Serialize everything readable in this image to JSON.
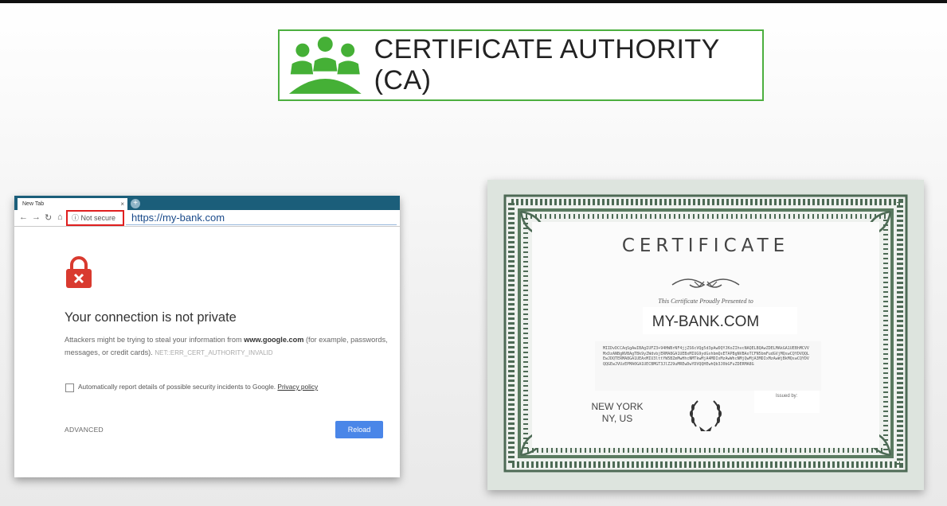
{
  "title": {
    "text": "CERTIFICATE AUTHORITY (CA)",
    "icon": "group-icon",
    "accent": "#4caf3f"
  },
  "browser": {
    "tab_label": "New Tab",
    "tab_close": "×",
    "new_tab": "+",
    "security_label": "Not secure",
    "url": "https://my-bank.com",
    "heading": "Your connection is not private",
    "body_before": "Attackers might be trying to steal your information from ",
    "body_domain": "www.google.com",
    "body_after": " (for example, passwords, messages, or credit cards). ",
    "error_code": "NET::ERR_CERT_AUTHORITY_INVALID",
    "checkbox_text": "Automatically report details of possible security incidents to Google. ",
    "privacy_link": "Privacy policy",
    "advanced": "ADVANCED",
    "reload": "Reload",
    "reload_color": "#4a86e8",
    "highlight_color": "#e01f1f"
  },
  "certificate": {
    "title": "CERTIFICATE",
    "presented": "This Certificate Proudly Presented to",
    "recipient": "MY-BANK.COM",
    "key": "MIIDvDCCAqSgAwIBAgIUFZ3+94HWBrNF4jjZS6cVQg5d3pAwDQYJKoZIhvcNAQELBQAwZDELMAkGA1UEBhMCVVMxDzANBgNVBAgTBk9yZWdvbjERMA8GA1UEBxMIUG9ydGxhbmQxETAPBgNVBAoTCFN5bmFudGVjMQswCQYDVQQLEwJDQTERMA8GA1UEAxMIU3lttYW5BZmMwHhcNMTkwMjA4MDIxMzAwWhcNMjQwMjA3MDIxMzAwWjBkMQswCQYDVQQGEwJVUzEPMA0GA1UECBMGT3JlZ29uMREwDwYDVQQHEwhQb3J0bGFuZDERMA8G",
    "location_line1": "NEW YORK",
    "location_line2": "NY, US",
    "issued_by": "Issued by:"
  }
}
